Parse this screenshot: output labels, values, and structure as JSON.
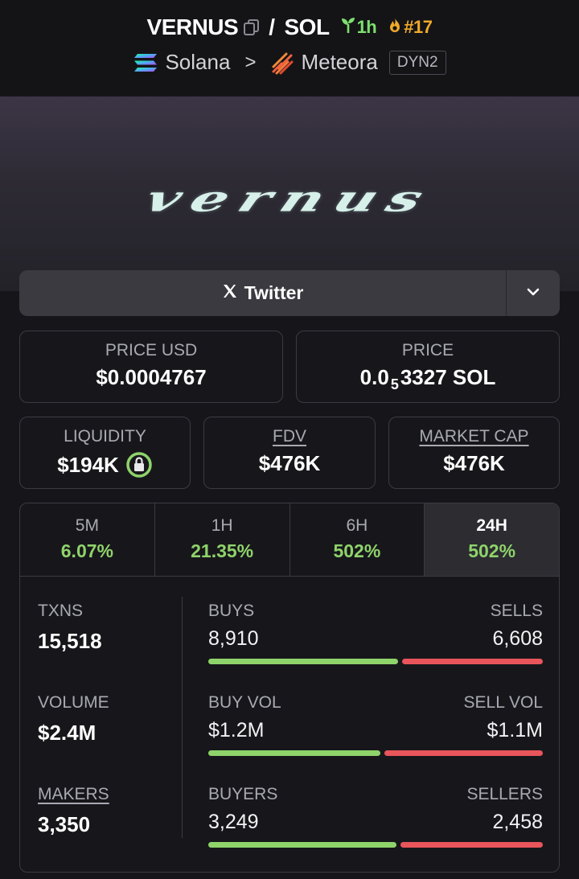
{
  "header": {
    "token": "VERNUS",
    "separator": "/",
    "quote": "SOL",
    "age": "1h",
    "rank": "#17",
    "chain": "Solana",
    "dex": "Meteora",
    "pool_badge": "DYN2",
    "age_color": "#7ee06d",
    "rank_color": "#f0a92a"
  },
  "banner": {
    "logo_text": "vernus"
  },
  "social": {
    "twitter_label": "Twitter"
  },
  "price": {
    "usd_label": "PRICE USD",
    "usd_value": "$0.0004767",
    "native_label": "PRICE",
    "native_prefix": "0.0",
    "native_zeros": "5",
    "native_rest": "3327 SOL"
  },
  "metrics": {
    "liquidity_label": "LIQUIDITY",
    "liquidity_value": "$194K",
    "fdv_label": "FDV",
    "fdv_value": "$476K",
    "mcap_label": "MARKET CAP",
    "mcap_value": "$476K"
  },
  "timeframes": [
    {
      "label": "5M",
      "change": "6.07%"
    },
    {
      "label": "1H",
      "change": "21.35%"
    },
    {
      "label": "6H",
      "change": "502%"
    },
    {
      "label": "24H",
      "change": "502%"
    }
  ],
  "stats": {
    "txns": {
      "label": "TXNS",
      "value": "15,518",
      "buy_label": "BUYS",
      "buy_value": "8,910",
      "sell_label": "SELLS",
      "sell_value": "6,608",
      "buy_fraction": 0.574
    },
    "volume": {
      "label": "VOLUME",
      "value": "$2.4M",
      "buy_label": "BUY VOL",
      "buy_value": "$1.2M",
      "sell_label": "SELL VOL",
      "sell_value": "$1.1M",
      "buy_fraction": 0.52
    },
    "makers": {
      "label": "MAKERS",
      "value": "3,350",
      "buy_label": "BUYERS",
      "buy_value": "3,249",
      "sell_label": "SELLERS",
      "sell_value": "2,458",
      "buy_fraction": 0.57
    }
  },
  "colors": {
    "positive": "#8fd36b",
    "buy_bar": "#8fd36b",
    "sell_bar": "#e8555a"
  }
}
